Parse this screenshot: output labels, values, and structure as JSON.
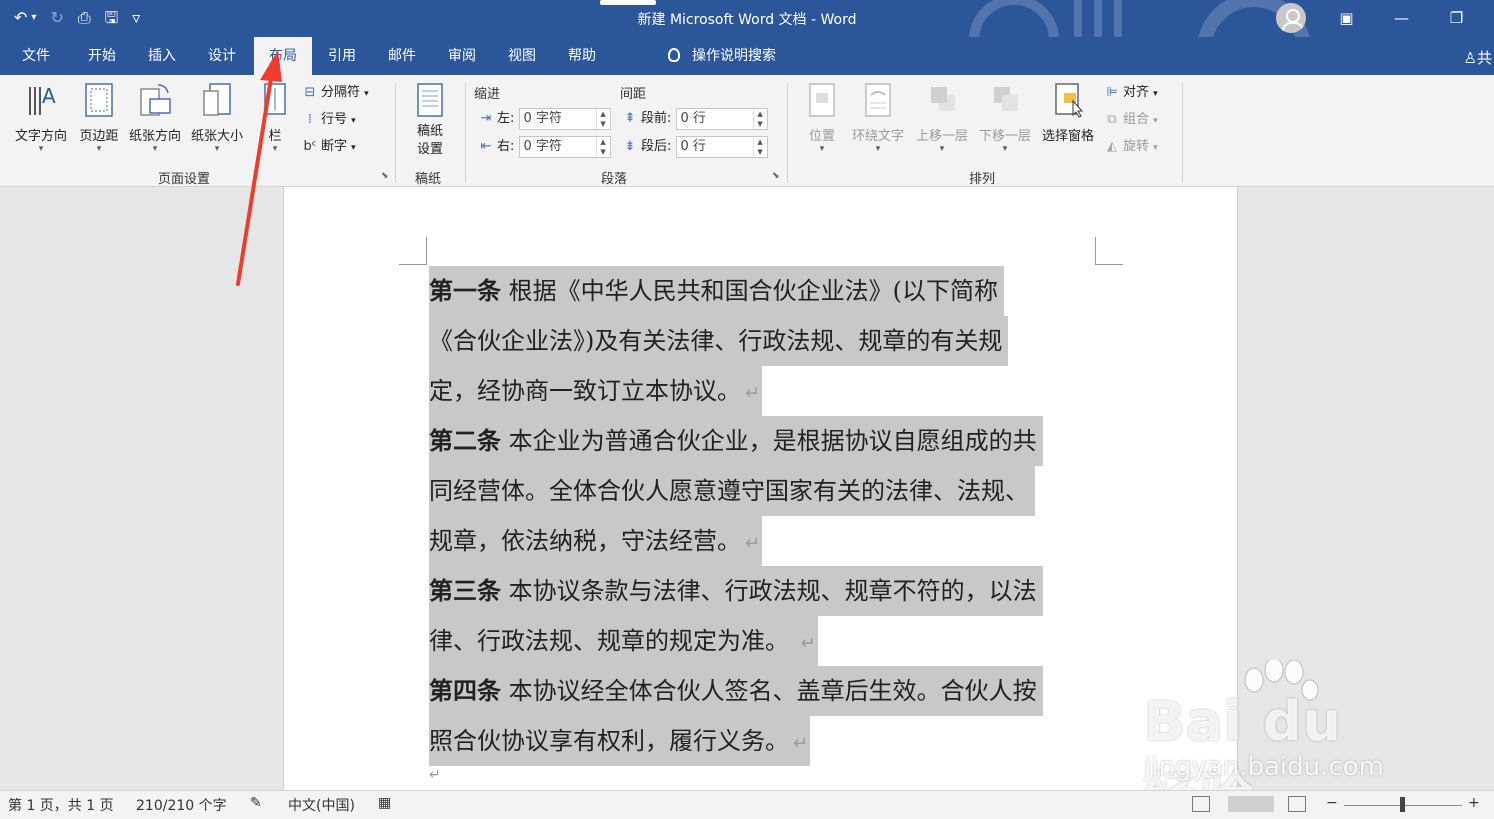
{
  "window": {
    "title": "新建 Microsoft Word 文档  -  Word",
    "qat": {
      "undo_icon": "↶",
      "undo_caret": "▾",
      "redo_icon": "↻",
      "preview_icon": "⎙",
      "save_icon": "🖫",
      "customize_icon": "▿"
    },
    "controls": {
      "ribbon_display": "▣",
      "minimize": "—",
      "restore": "❐"
    },
    "share_label": "♙共"
  },
  "tabs": [
    {
      "label": "文件"
    },
    {
      "label": "开始"
    },
    {
      "label": "插入"
    },
    {
      "label": "设计"
    },
    {
      "label": "布局"
    },
    {
      "label": "引用"
    },
    {
      "label": "邮件"
    },
    {
      "label": "审阅"
    },
    {
      "label": "视图"
    },
    {
      "label": "帮助"
    }
  ],
  "active_tab": "布局",
  "search": {
    "label": "操作说明搜索"
  },
  "ribbon": {
    "page_setup": {
      "label": "页面设置",
      "buttons": [
        {
          "label": "文字方向",
          "caret": "▾"
        },
        {
          "label": "页边距",
          "caret": "▾"
        },
        {
          "label": "纸张方向",
          "caret": "▾"
        },
        {
          "label": "纸张大小",
          "caret": "▾"
        },
        {
          "label": "栏",
          "caret": "▾"
        }
      ],
      "small": [
        {
          "icon": "⊟",
          "label": "分隔符",
          "caret": "▾"
        },
        {
          "icon": "⁞",
          "label": "行号",
          "caret": "▾"
        },
        {
          "icon": "bᶜ",
          "label": "断字",
          "caret": "▾"
        }
      ],
      "launcher": "⬊"
    },
    "manuscript": {
      "label": "稿纸",
      "button": "稿纸\n设置"
    },
    "paragraph": {
      "label": "段落",
      "indent_head": "缩进",
      "spacing_head": "间距",
      "left_label": "左:",
      "left_value": "0 字符",
      "right_label": "右:",
      "right_value": "0 字符",
      "before_label": "段前:",
      "before_value": "0 行",
      "after_label": "段后:",
      "after_value": "0 行",
      "spin_up": "▲",
      "spin_down": "▼",
      "launcher": "⬊"
    },
    "arrange": {
      "label": "排列",
      "buttons": [
        {
          "label": "位置",
          "caret": "▾",
          "enabled": false
        },
        {
          "label": "环绕文字",
          "caret": "▾",
          "enabled": false
        },
        {
          "label": "上移一层",
          "caret": "▾",
          "enabled": false
        },
        {
          "label": "下移一层",
          "caret": "▾",
          "enabled": false
        },
        {
          "label": "选择窗格",
          "caret": "",
          "enabled": true
        }
      ],
      "small": [
        {
          "icon": "⊫",
          "label": "对齐",
          "caret": "▾",
          "enabled": true
        },
        {
          "icon": "⧉",
          "label": "组合",
          "caret": "▾",
          "enabled": false
        },
        {
          "icon": "◭",
          "label": "旋转",
          "caret": "▾",
          "enabled": false
        }
      ]
    }
  },
  "document": {
    "lines": [
      {
        "bold": "第一条",
        "text": "  根据《中华人民共和国合伙企业法》(以下简称",
        "pilcrow": ""
      },
      {
        "bold": "",
        "text": "《合伙企业法》)及有关法律、行政法规、规章的有关规",
        "pilcrow": ""
      },
      {
        "bold": "",
        "text": "定，经协商一致订立本协议。",
        "pilcrow": "↵"
      },
      {
        "bold": "第二条",
        "text": "  本企业为普通合伙企业，是根据协议自愿组成的共",
        "pilcrow": ""
      },
      {
        "bold": "",
        "text": "同经营体。全体合伙人愿意遵守国家有关的法律、法规、",
        "pilcrow": ""
      },
      {
        "bold": "",
        "text": "规章，依法纳税，守法经营。",
        "pilcrow": "↵"
      },
      {
        "bold": "第三条",
        "text": "  本协议条款与法律、行政法规、规章不符的，以法",
        "pilcrow": ""
      },
      {
        "bold": "",
        "text": "律、行政法规、规章的规定为准。 ",
        "pilcrow": "↵"
      },
      {
        "bold": "第四条",
        "text": "  本协议经全体合伙人签名、盖章后生效。合伙人按",
        "pilcrow": ""
      },
      {
        "bold": "",
        "text": "照合伙协议享有权利，履行义务。",
        "pilcrow": "↵"
      }
    ],
    "end_mark": "↵"
  },
  "watermark": {
    "brand": "Bai du 经验",
    "url": "jingyan.baidu.com"
  },
  "status": {
    "page": "第 1 页，共 1 页",
    "words": "210/210 个字",
    "proof_icon": "✎",
    "language": "中文(中国)",
    "macro_icon": "▦",
    "zoom_minus": "−",
    "zoom_plus": "+"
  }
}
